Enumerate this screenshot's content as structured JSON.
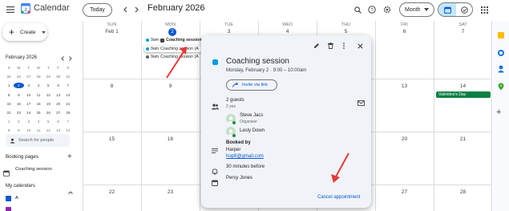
{
  "topbar": {
    "app_title": "Calendar",
    "today_label": "Today",
    "month_title": "February 2026",
    "view_label": "Month",
    "icons": [
      "menu-icon",
      "calendar-logo-icon",
      "chevron-left-icon",
      "chevron-right-icon",
      "search-icon",
      "help-icon",
      "settings-icon",
      "calendar-view-icon",
      "tasks-view-icon",
      "apps-grid-icon"
    ]
  },
  "sidebar": {
    "create_label": "Create",
    "mini_month": "February 2026",
    "mini_weekdays": [
      "S",
      "M",
      "T",
      "W",
      "T",
      "F",
      "S"
    ],
    "mini_days": [
      "25",
      "26",
      "27",
      "28",
      "29",
      "30",
      "31",
      "1",
      "2",
      "3",
      "4",
      "5",
      "6",
      "7",
      "8",
      "9",
      "10",
      "11",
      "12",
      "13",
      "14",
      "15",
      "16",
      "17",
      "18",
      "19",
      "20",
      "21",
      "22",
      "23",
      "24",
      "25",
      "26",
      "27",
      "28",
      "1",
      "2",
      "3",
      "4",
      "5",
      "6",
      "7",
      "8",
      "9",
      "10",
      "11",
      "12",
      "13",
      "14"
    ],
    "mini_selected": "2",
    "search_people_placeholder": "Search for people",
    "booking_pages_label": "Booking pages",
    "booking_item": "Coaching session",
    "my_calendars_label": "My calendars",
    "calendar_items": [
      "A",
      ""
    ]
  },
  "grid": {
    "weekdays": [
      "SUN",
      "MON",
      "TUE",
      "WED",
      "THU",
      "FRI",
      "SAT"
    ],
    "row1_dates": [
      "Feb 1",
      "2",
      "3",
      "4",
      "5",
      "6",
      "7"
    ],
    "row2_dates": [
      "8",
      "9",
      "10",
      "11",
      "12",
      "13",
      "14"
    ],
    "row3_dates": [
      "15",
      "16",
      "17",
      "18",
      "19",
      "20",
      "21"
    ],
    "row4_dates": [
      "22",
      "23",
      "24",
      "25",
      "26",
      "27",
      "28"
    ],
    "events": [
      {
        "time": "9am",
        "title": "Coaching session"
      },
      {
        "time": "9am",
        "title": "Coaching session (A"
      },
      {
        "time": "9am",
        "title": "Coaching session (A"
      }
    ],
    "valentines": "Valentine's Day",
    "colors": {
      "accent": "#0b57d0",
      "event_dot": "#039be5",
      "valentine": "#0b8043"
    }
  },
  "popup": {
    "title": "Coaching session",
    "datetime": "Monday, February 2  ·  9:00 – 10:00am",
    "invite_label": "Invite via link",
    "guests_count": "2 guests",
    "guests_yes": "2 yes",
    "guest1_name": "Steve Jacs",
    "guest1_role": "Organizer",
    "guest2_name": "Lesly Down",
    "booked_by_label": "Booked by",
    "booked_by_name": "Harper",
    "booked_by_email": "hop8@gmail.com",
    "reminder": "30 minutes before",
    "owner": "Persy Jones",
    "cancel_label": "Cancel appointment"
  }
}
